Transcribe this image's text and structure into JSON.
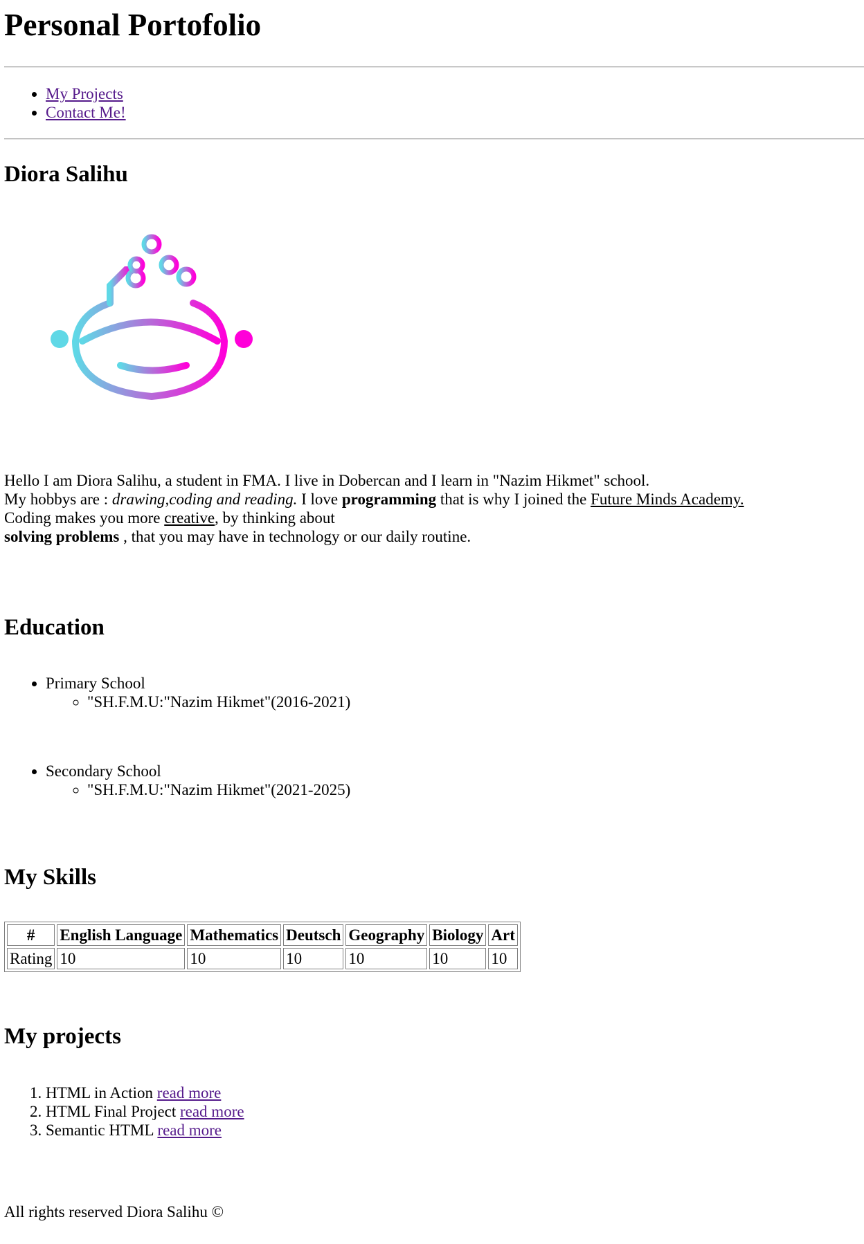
{
  "header": {
    "title": "Personal Portofolio"
  },
  "nav": {
    "items": [
      {
        "label": "My Projects"
      },
      {
        "label": "Contact Me!"
      }
    ]
  },
  "profile": {
    "name": "Diora Salihu",
    "logo_icon": "robot-brain-logo-icon",
    "colors": {
      "cyan": "#5fd8e6",
      "magenta": "#ff00d9",
      "violet": "#b56cd8"
    }
  },
  "about": {
    "line1": "Hello I am Diora Salihu, a student in FMA. I live in Dobercan and I learn in \"Nazim Hikmet\" school.",
    "line2_prefix": "My hobbys are : ",
    "hobbies": "drawing,coding and reading.",
    "line2_mid": " I love ",
    "programming": "programming",
    "line2_mid2": " that is why I joined the ",
    "academy_link": "Future Minds Academy.",
    "line3_prefix": "Coding makes you more ",
    "creative_link": "creative",
    "line3_suffix": ", by thinking about",
    "solving": "solving problems",
    "line4_suffix": " , that you may have in technology or our daily routine."
  },
  "education": {
    "title": "Education",
    "items": [
      {
        "level": "Primary School",
        "school": "\"SH.F.M.U:\"Nazim Hikmet\"(2016-2021)"
      },
      {
        "level": "Secondary School",
        "school": "\"SH.F.M.U:\"Nazim Hikmet\"(2021-2025)"
      }
    ]
  },
  "skills": {
    "title": "My Skills",
    "headers": [
      "#",
      "English Language",
      "Mathematics",
      "Deutsch",
      "Geography",
      "Biology",
      "Art"
    ],
    "row": [
      "Rating",
      "10",
      "10",
      "10",
      "10",
      "10",
      "10"
    ]
  },
  "projects": {
    "title": "My projects",
    "items": [
      {
        "name": "HTML in Action",
        "link": "read more"
      },
      {
        "name": "HTML Final Project",
        "link": "read more"
      },
      {
        "name": "Semantic HTML",
        "link": "read more"
      }
    ]
  },
  "footer": {
    "text": "All rights reserved Diora Salihu ©"
  }
}
